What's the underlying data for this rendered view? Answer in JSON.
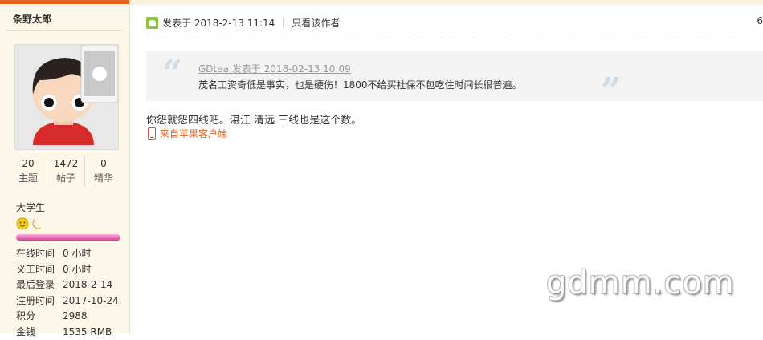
{
  "author": {
    "username": "条野太郎",
    "stats": [
      {
        "value": "20",
        "label": "主题"
      },
      {
        "value": "1472",
        "label": "帖子"
      },
      {
        "value": "0",
        "label": "精华"
      }
    ],
    "group": "大学生",
    "info": [
      {
        "key": "在线时间",
        "value": "0 小时"
      },
      {
        "key": "义工时间",
        "value": "0 小时"
      },
      {
        "key": "最后登录",
        "value": "2018-2-14"
      },
      {
        "key": "注册时间",
        "value": "2017-10-24"
      },
      {
        "key": "积分",
        "value": "2988"
      },
      {
        "key": "金钱",
        "value": "1535 RMB"
      }
    ]
  },
  "post": {
    "posted_at": "发表于 2018-2-13 11:14",
    "only_author": "只看该作者",
    "floor": "6",
    "quote_author": "GDtea 发表于 2018-02-13 10:09",
    "quote_text": "茂名工资奇低是事实，也是硬伤！1800不给买社保不包吃住时间长很普遍。",
    "content": "你怨就怨四线吧。湛江 清远 三线也是这个数。",
    "source": "来自苹果客户端"
  },
  "watermark": "gdmm.com",
  "colors": {
    "accent": "#e8631f",
    "sidebar_bg": "#fdf7ea",
    "quote_bg": "#f3f3f3"
  }
}
